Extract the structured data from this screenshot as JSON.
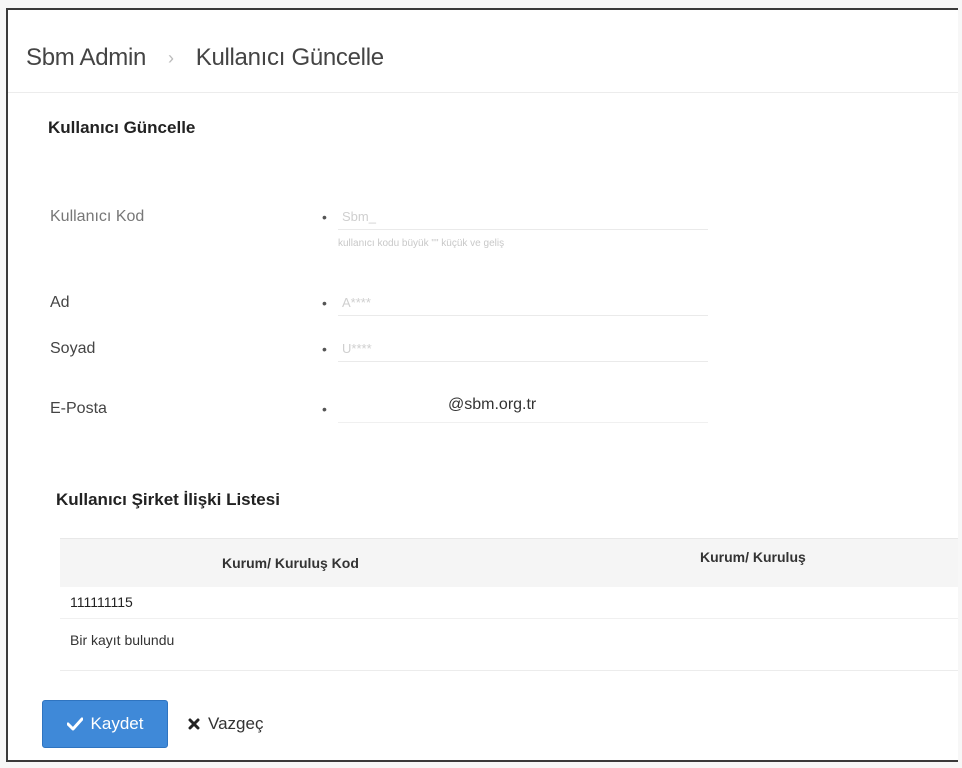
{
  "breadcrumb": {
    "root": "Sbm Admin",
    "current": "Kullanıcı Güncelle"
  },
  "form": {
    "title": "Kullanıcı Güncelle",
    "fields": [
      {
        "label": "Kullanıcı Kod",
        "placeholder": "Sbm_",
        "helper": "kullanıcı kodu büyük \"\" küçük ve geliş"
      },
      {
        "label": "Ad",
        "placeholder": "A****"
      },
      {
        "label": "Soyad",
        "placeholder": "U****"
      },
      {
        "label": "E-Posta",
        "value": "@sbm.org.tr"
      }
    ],
    "required_mark": "•"
  },
  "relations": {
    "title": "Kullanıcı Şirket İlişki Listesi",
    "columns": [
      "Kurum/ Kuruluş Kod",
      "Kurum/ Kuruluş"
    ],
    "rows": [
      [
        "111111115",
        ""
      ]
    ],
    "footer": "Bir kayıt bulundu"
  },
  "actions": {
    "save_label": "Kaydet",
    "cancel_label": "Vazgeç"
  },
  "colors": {
    "primary": "#3f89d8"
  },
  "icons": {
    "breadcrumb_separator": "chevron-right-icon",
    "save": "check-icon",
    "cancel": "times-icon"
  }
}
